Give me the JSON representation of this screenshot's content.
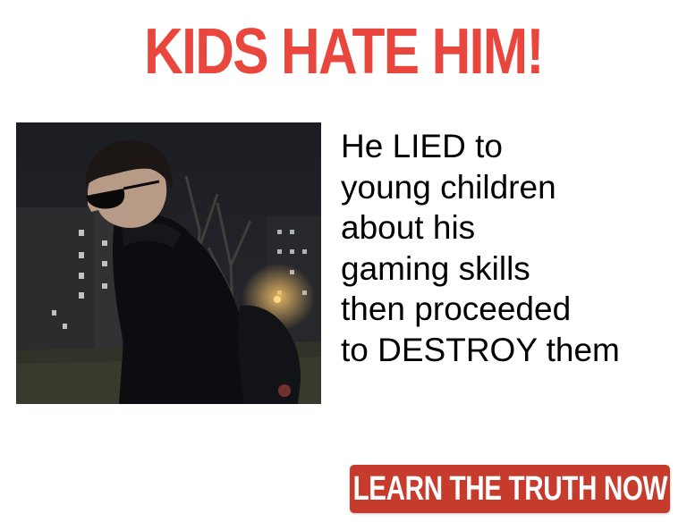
{
  "ad": {
    "headline": "KIDS HATE HIM!",
    "story_lines": [
      "He LIED to",
      "young children",
      "about his",
      "gaming skills",
      "then proceeded",
      "to DESTROY them"
    ],
    "cta_label": "LEARN THE TRUTH NOW",
    "photo": "man-in-sunglasses-at-night"
  },
  "colors": {
    "headline": "#e9473e",
    "cta_background": "#c63b2c",
    "cta_text": "#ffffff",
    "story_text": "#000000",
    "page_background": "#ffffff"
  }
}
